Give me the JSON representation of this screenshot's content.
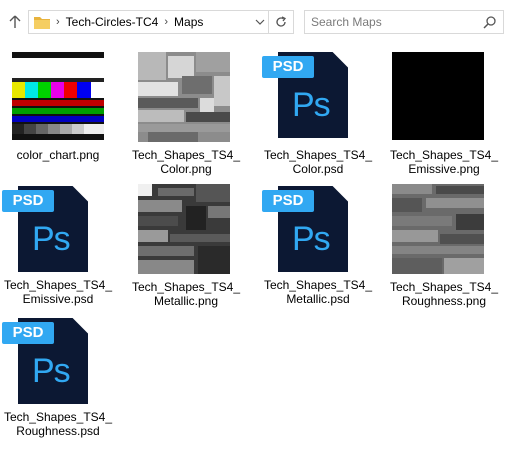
{
  "nav": {
    "breadcrumb": [
      "Tech-Circles-TC4",
      "Maps"
    ],
    "search_placeholder": "Search Maps"
  },
  "files": [
    {
      "name": "color_chart.png",
      "kind": "color-chart"
    },
    {
      "name": "Tech_Shapes_TS4_Color.png",
      "kind": "texture-light"
    },
    {
      "name": "Tech_Shapes_TS4_Color.psd",
      "kind": "psd"
    },
    {
      "name": "Tech_Shapes_TS4_Emissive.png",
      "kind": "black"
    },
    {
      "name": "Tech_Shapes_TS4_Emissive.psd",
      "kind": "psd"
    },
    {
      "name": "Tech_Shapes_TS4_Metallic.png",
      "kind": "texture-dark"
    },
    {
      "name": "Tech_Shapes_TS4_Metallic.psd",
      "kind": "psd"
    },
    {
      "name": "Tech_Shapes_TS4_Roughness.png",
      "kind": "texture-mid"
    },
    {
      "name": "Tech_Shapes_TS4_Roughness.psd",
      "kind": "psd"
    }
  ],
  "psd_tag": "PSD",
  "psd_logo": "Ps",
  "colors": {
    "psd_blue": "#31a8f2",
    "psd_navy": "#0c1833",
    "folder_yellow": "#f1c550"
  }
}
